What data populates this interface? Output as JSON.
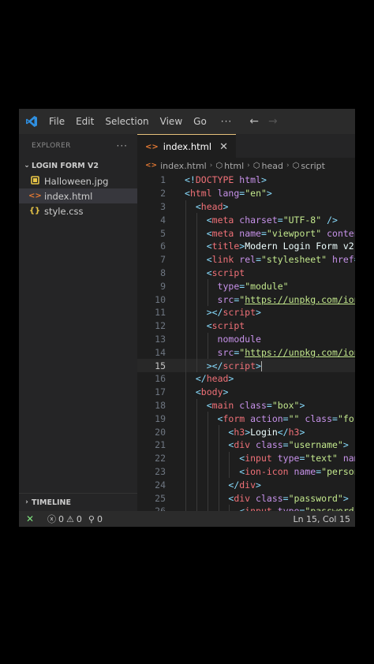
{
  "titlebar": {
    "menu": [
      "File",
      "Edit",
      "Selection",
      "View",
      "Go"
    ],
    "more": "···",
    "back_icon": "←",
    "forward_icon": "→"
  },
  "sidebar": {
    "header": "EXPLORER",
    "more": "···",
    "folder": "LOGIN FORM V2",
    "files": [
      {
        "name": "Halloween.jpg",
        "icon": "image-icon",
        "color": "#e8c547"
      },
      {
        "name": "index.html",
        "icon": "html-icon",
        "color": "#e37933",
        "active": true
      },
      {
        "name": "style.css",
        "icon": "css-braces-icon",
        "color": "#e8c547"
      }
    ],
    "timeline": "TIMELINE"
  },
  "editor": {
    "tab": {
      "label": "index.html",
      "close": "✕"
    },
    "breadcrumb": [
      "index.html",
      "html",
      "head",
      "script"
    ],
    "current_line": 15,
    "lines": [
      {
        "n": 1,
        "indent": 0,
        "seg": [
          [
            "p",
            "<!"
          ],
          [
            "t",
            "DOCTYPE"
          ],
          [
            "p",
            " "
          ],
          [
            "a",
            "html"
          ],
          [
            "p",
            ">"
          ]
        ]
      },
      {
        "n": 2,
        "indent": 0,
        "seg": [
          [
            "p",
            "<"
          ],
          [
            "t",
            "html"
          ],
          [
            "p",
            " "
          ],
          [
            "a",
            "lang"
          ],
          [
            "p",
            "="
          ],
          [
            "s",
            "\"en\""
          ],
          [
            "p",
            ">"
          ]
        ]
      },
      {
        "n": 3,
        "indent": 1,
        "seg": [
          [
            "p",
            "<"
          ],
          [
            "t",
            "head"
          ],
          [
            "p",
            ">"
          ]
        ]
      },
      {
        "n": 4,
        "indent": 2,
        "seg": [
          [
            "p",
            "<"
          ],
          [
            "t",
            "meta"
          ],
          [
            "p",
            " "
          ],
          [
            "a",
            "charset"
          ],
          [
            "p",
            "="
          ],
          [
            "s",
            "\"UTF-8\""
          ],
          [
            "p",
            " />"
          ]
        ]
      },
      {
        "n": 5,
        "indent": 2,
        "seg": [
          [
            "p",
            "<"
          ],
          [
            "t",
            "meta"
          ],
          [
            "p",
            " "
          ],
          [
            "a",
            "name"
          ],
          [
            "p",
            "="
          ],
          [
            "s",
            "\"viewport\""
          ],
          [
            "p",
            " "
          ],
          [
            "a",
            "conten"
          ]
        ]
      },
      {
        "n": 6,
        "indent": 2,
        "seg": [
          [
            "p",
            "<"
          ],
          [
            "t",
            "title"
          ],
          [
            "p",
            ">"
          ],
          [
            "x",
            "Modern Login Form v2"
          ]
        ]
      },
      {
        "n": 7,
        "indent": 2,
        "seg": [
          [
            "p",
            "<"
          ],
          [
            "t",
            "link"
          ],
          [
            "p",
            " "
          ],
          [
            "a",
            "rel"
          ],
          [
            "p",
            "="
          ],
          [
            "s",
            "\"stylesheet\""
          ],
          [
            "p",
            " "
          ],
          [
            "a",
            "href"
          ],
          [
            "p",
            "="
          ]
        ]
      },
      {
        "n": 8,
        "indent": 2,
        "seg": [
          [
            "p",
            "<"
          ],
          [
            "t",
            "script"
          ]
        ]
      },
      {
        "n": 9,
        "indent": 3,
        "seg": [
          [
            "a",
            "type"
          ],
          [
            "p",
            "="
          ],
          [
            "s",
            "\"module\""
          ]
        ]
      },
      {
        "n": 10,
        "indent": 3,
        "seg": [
          [
            "a",
            "src"
          ],
          [
            "p",
            "="
          ],
          [
            "s",
            "\""
          ],
          [
            "u",
            "https://unpkg.com/ion"
          ]
        ]
      },
      {
        "n": 11,
        "indent": 2,
        "seg": [
          [
            "p",
            "></"
          ],
          [
            "t",
            "script"
          ],
          [
            "p",
            ">"
          ]
        ]
      },
      {
        "n": 12,
        "indent": 2,
        "seg": [
          [
            "p",
            "<"
          ],
          [
            "t",
            "script"
          ]
        ]
      },
      {
        "n": 13,
        "indent": 3,
        "seg": [
          [
            "a",
            "nomodule"
          ]
        ]
      },
      {
        "n": 14,
        "indent": 3,
        "seg": [
          [
            "a",
            "src"
          ],
          [
            "p",
            "="
          ],
          [
            "s",
            "\""
          ],
          [
            "u",
            "https://unpkg.com/ion"
          ]
        ]
      },
      {
        "n": 15,
        "indent": 2,
        "seg": [
          [
            "p",
            "></"
          ],
          [
            "t",
            "script"
          ],
          [
            "p",
            ">"
          ]
        ]
      },
      {
        "n": 16,
        "indent": 1,
        "seg": [
          [
            "p",
            "</"
          ],
          [
            "t",
            "head"
          ],
          [
            "p",
            ">"
          ]
        ]
      },
      {
        "n": 17,
        "indent": 1,
        "seg": [
          [
            "p",
            "<"
          ],
          [
            "t",
            "body"
          ],
          [
            "p",
            ">"
          ]
        ]
      },
      {
        "n": 18,
        "indent": 2,
        "seg": [
          [
            "p",
            "<"
          ],
          [
            "t",
            "main"
          ],
          [
            "p",
            " "
          ],
          [
            "a",
            "class"
          ],
          [
            "p",
            "="
          ],
          [
            "s",
            "\"box\""
          ],
          [
            "p",
            ">"
          ]
        ]
      },
      {
        "n": 19,
        "indent": 3,
        "seg": [
          [
            "p",
            "<"
          ],
          [
            "t",
            "form"
          ],
          [
            "p",
            " "
          ],
          [
            "a",
            "action"
          ],
          [
            "p",
            "="
          ],
          [
            "s",
            "\"\""
          ],
          [
            "p",
            " "
          ],
          [
            "a",
            "class"
          ],
          [
            "p",
            "="
          ],
          [
            "s",
            "\"for"
          ]
        ]
      },
      {
        "n": 20,
        "indent": 4,
        "seg": [
          [
            "p",
            "<"
          ],
          [
            "t",
            "h3"
          ],
          [
            "p",
            ">"
          ],
          [
            "x",
            "Login"
          ],
          [
            "p",
            "</"
          ],
          [
            "t",
            "h3"
          ],
          [
            "p",
            ">"
          ]
        ]
      },
      {
        "n": 21,
        "indent": 4,
        "seg": [
          [
            "p",
            "<"
          ],
          [
            "t",
            "div"
          ],
          [
            "p",
            " "
          ],
          [
            "a",
            "class"
          ],
          [
            "p",
            "="
          ],
          [
            "s",
            "\"username\""
          ],
          [
            "p",
            ">"
          ]
        ]
      },
      {
        "n": 22,
        "indent": 5,
        "seg": [
          [
            "p",
            "<"
          ],
          [
            "t",
            "input"
          ],
          [
            "p",
            " "
          ],
          [
            "a",
            "type"
          ],
          [
            "p",
            "="
          ],
          [
            "s",
            "\"text\""
          ],
          [
            "p",
            " "
          ],
          [
            "a",
            "nam"
          ]
        ]
      },
      {
        "n": 23,
        "indent": 5,
        "seg": [
          [
            "p",
            "<"
          ],
          [
            "t",
            "ion-icon"
          ],
          [
            "p",
            " "
          ],
          [
            "a",
            "name"
          ],
          [
            "p",
            "="
          ],
          [
            "s",
            "\"person"
          ]
        ]
      },
      {
        "n": 24,
        "indent": 4,
        "seg": [
          [
            "p",
            "</"
          ],
          [
            "t",
            "div"
          ],
          [
            "p",
            ">"
          ]
        ]
      },
      {
        "n": 25,
        "indent": 4,
        "seg": [
          [
            "p",
            "<"
          ],
          [
            "t",
            "div"
          ],
          [
            "p",
            " "
          ],
          [
            "a",
            "class"
          ],
          [
            "p",
            "="
          ],
          [
            "s",
            "\"password\""
          ],
          [
            "p",
            ">"
          ]
        ]
      },
      {
        "n": 26,
        "indent": 5,
        "seg": [
          [
            "p",
            "<"
          ],
          [
            "t",
            "input"
          ],
          [
            "p",
            " "
          ],
          [
            "a",
            "type"
          ],
          [
            "p",
            "="
          ],
          [
            "s",
            "\"password\""
          ]
        ]
      }
    ]
  },
  "statusbar": {
    "errors": "0",
    "warnings": "0",
    "ports": "0",
    "position": "Ln 15, Col 15"
  },
  "colors": {
    "tag": "#f07178",
    "attr": "#c792ea",
    "string": "#c3e88d",
    "punct": "#89ddff",
    "text": "#eeffff",
    "accent": "#e5c07b"
  }
}
